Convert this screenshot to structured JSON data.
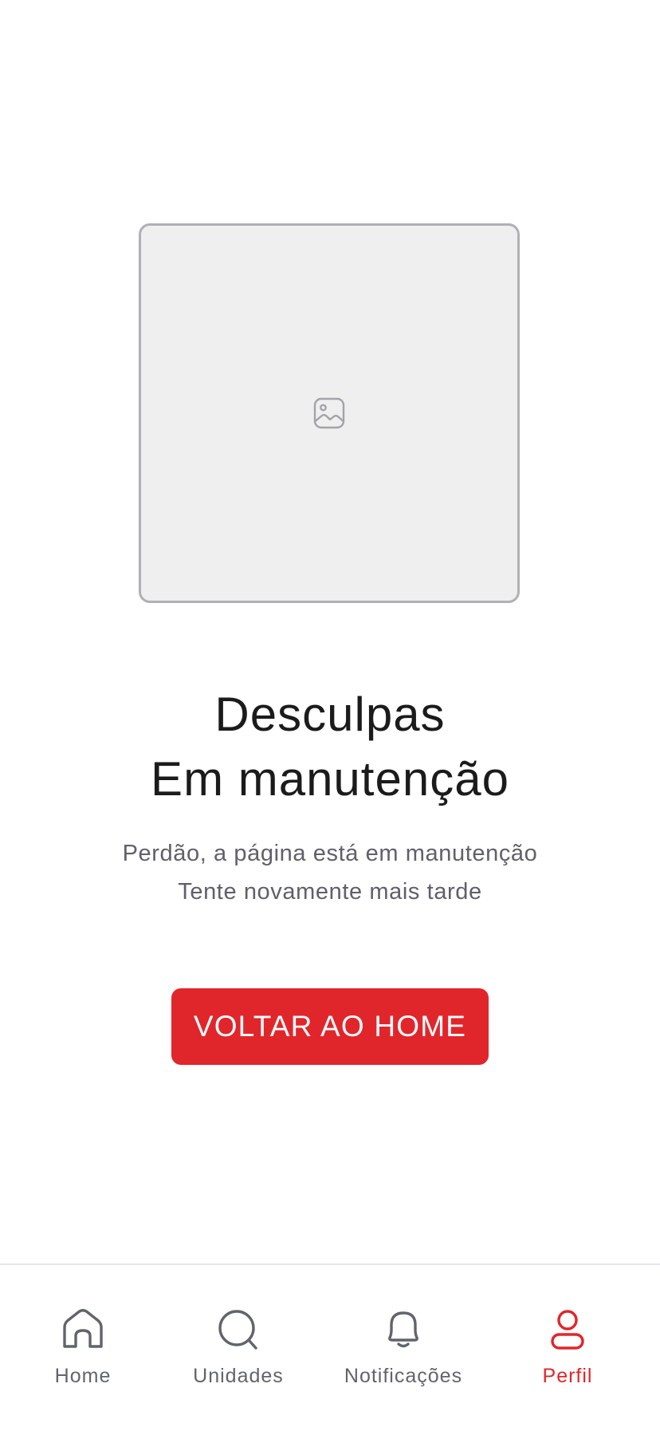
{
  "illustration": {
    "icon": "image-icon"
  },
  "message": {
    "title_line1": "Desculpas",
    "title_line2": "Em manutenção",
    "subtitle_line1": "Perdão, a página está em manutenção",
    "subtitle_line2": "Tente novamente mais tarde"
  },
  "cta": {
    "label": "VOLTAR AO HOME"
  },
  "bottom_nav": {
    "active": "Perfil",
    "items": [
      {
        "label": "Home",
        "icon": "home-icon"
      },
      {
        "label": "Unidades",
        "icon": "search-icon"
      },
      {
        "label": "Notificações",
        "icon": "bell-icon"
      },
      {
        "label": "Perfil",
        "icon": "user-icon"
      }
    ]
  },
  "colors": {
    "accent": "#e1262b",
    "text_primary": "#1b1b1b",
    "text_secondary": "#5f6068",
    "placeholder_bg": "#efefef",
    "placeholder_border": "#b0b0b6"
  }
}
